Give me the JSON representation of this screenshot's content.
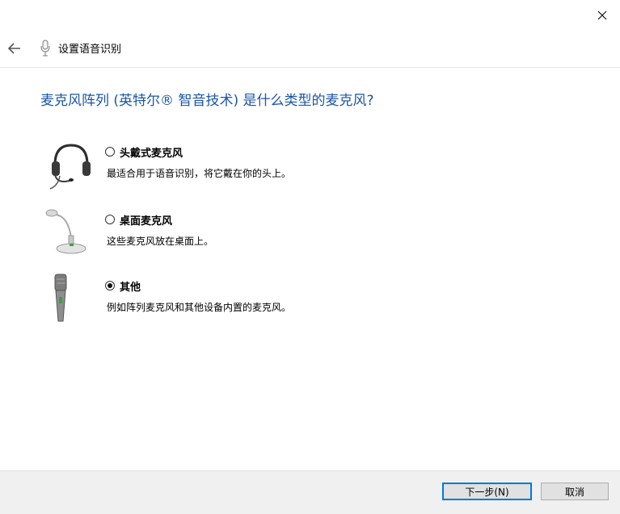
{
  "nav": {
    "title": "设置语音识别",
    "back_icon": "back-arrow-icon",
    "app_icon": "microphone-icon"
  },
  "question": "麦克风阵列 (英特尔® 智音技术) 是什么类型的麦克风?",
  "options": [
    {
      "label": "头戴式麦克风",
      "description": "最适合用于语音识别，将它戴在你的头上。",
      "selected": false,
      "icon": "headset-icon"
    },
    {
      "label": "桌面麦克风",
      "description": "这些麦克风放在桌面上。",
      "selected": false,
      "icon": "desktop-microphone-icon"
    },
    {
      "label": "其他",
      "description": "例如阵列麦克风和其他设备内置的麦克风。",
      "selected": true,
      "icon": "handheld-microphone-icon"
    }
  ],
  "buttons": {
    "next": "下一步(N)",
    "cancel": "取消"
  },
  "colors": {
    "question_text": "#1b55a5",
    "default_button_border": "#0078d7",
    "footer_bg": "#f0f0f0"
  }
}
